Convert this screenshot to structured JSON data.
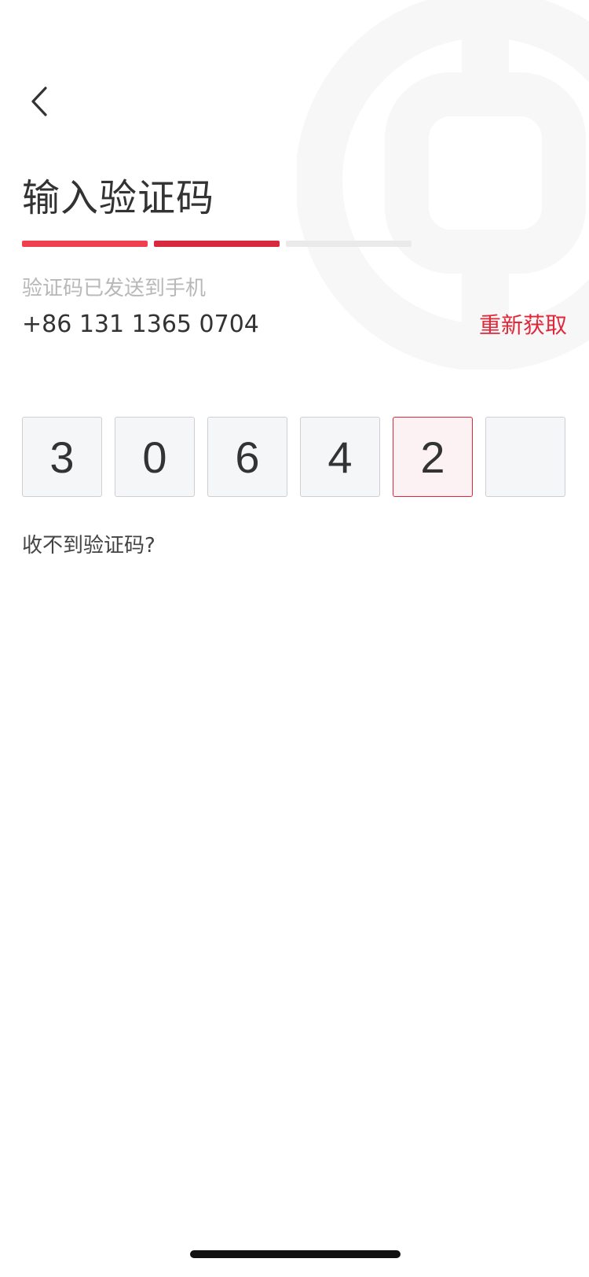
{
  "header": {
    "back_icon": "chevron-left-icon",
    "title": "输入验证码"
  },
  "progress": {
    "total_steps": 3,
    "completed_steps": 2,
    "colors": [
      "#f0404f",
      "#d9293f",
      "#eaeaea"
    ]
  },
  "verification": {
    "hint": "验证码已发送到手机",
    "phone": "+86 131 1365 0704",
    "resend_label": "重新获取",
    "code_digits": [
      "3",
      "0",
      "6",
      "4",
      "2",
      ""
    ],
    "active_index": 4,
    "no_code_label": "收不到验证码?"
  },
  "colors": {
    "accent": "#e0283a",
    "title": "#333333",
    "hint": "#b8b8b8"
  },
  "watermark_icon": "bank-of-china-logo-icon"
}
